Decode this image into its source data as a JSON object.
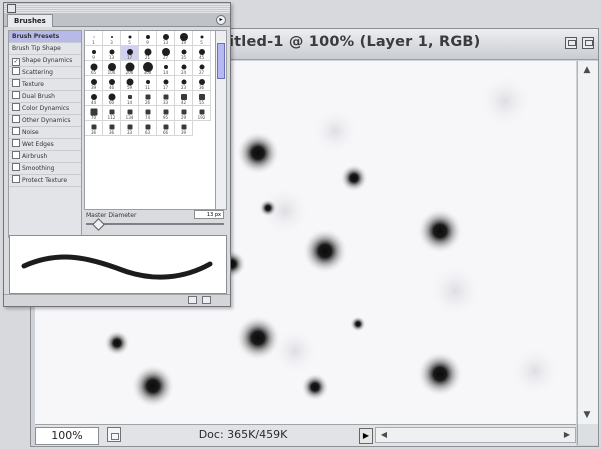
{
  "document": {
    "title": "itled-1 @ 100% (Layer 1, RGB)",
    "zoom": "100%",
    "doc_info": "Doc: 365K/459K"
  },
  "palette": {
    "tab_label": "Brushes",
    "options": [
      {
        "label": "Brush Presets",
        "checkbox": false,
        "checked": false,
        "selected": true
      },
      {
        "label": "Brush Tip Shape",
        "checkbox": false,
        "checked": false,
        "selected": false
      },
      {
        "label": "Shape Dynamics",
        "checkbox": true,
        "checked": true,
        "selected": false
      },
      {
        "label": "Scattering",
        "checkbox": true,
        "checked": false,
        "selected": false
      },
      {
        "label": "Texture",
        "checkbox": true,
        "checked": false,
        "selected": false
      },
      {
        "label": "Dual Brush",
        "checkbox": true,
        "checked": false,
        "selected": false
      },
      {
        "label": "Color Dynamics",
        "checkbox": true,
        "checked": false,
        "selected": false
      },
      {
        "label": "Other Dynamics",
        "checkbox": true,
        "checked": false,
        "selected": false
      },
      {
        "label": "Noise",
        "checkbox": true,
        "checked": false,
        "selected": false
      },
      {
        "label": "Wet Edges",
        "checkbox": true,
        "checked": false,
        "selected": false
      },
      {
        "label": "Airbrush",
        "checkbox": true,
        "checked": false,
        "selected": false
      },
      {
        "label": "Smoothing",
        "checkbox": true,
        "checked": false,
        "selected": false
      },
      {
        "label": "Protect Texture",
        "checkbox": true,
        "checked": false,
        "selected": false
      }
    ],
    "brush_sizes": [
      "1",
      "3",
      "5",
      "9",
      "13",
      "19",
      "5",
      "9",
      "13",
      "17",
      "21",
      "27",
      "35",
      "45",
      "65",
      "100",
      "200",
      "300",
      "14",
      "24",
      "27",
      "39",
      "46",
      "59",
      "11",
      "17",
      "23",
      "36",
      "44",
      "60",
      "14",
      "26",
      "33",
      "42",
      "55",
      "70",
      "112",
      "134",
      "74",
      "95",
      "29",
      "192",
      "36",
      "36",
      "33",
      "63",
      "66",
      "39"
    ],
    "master_diameter_label": "Master Diameter",
    "master_diameter_value": "13 px"
  },
  "colors": {
    "selection": "#b7b9e8",
    "ink": "#111111"
  }
}
